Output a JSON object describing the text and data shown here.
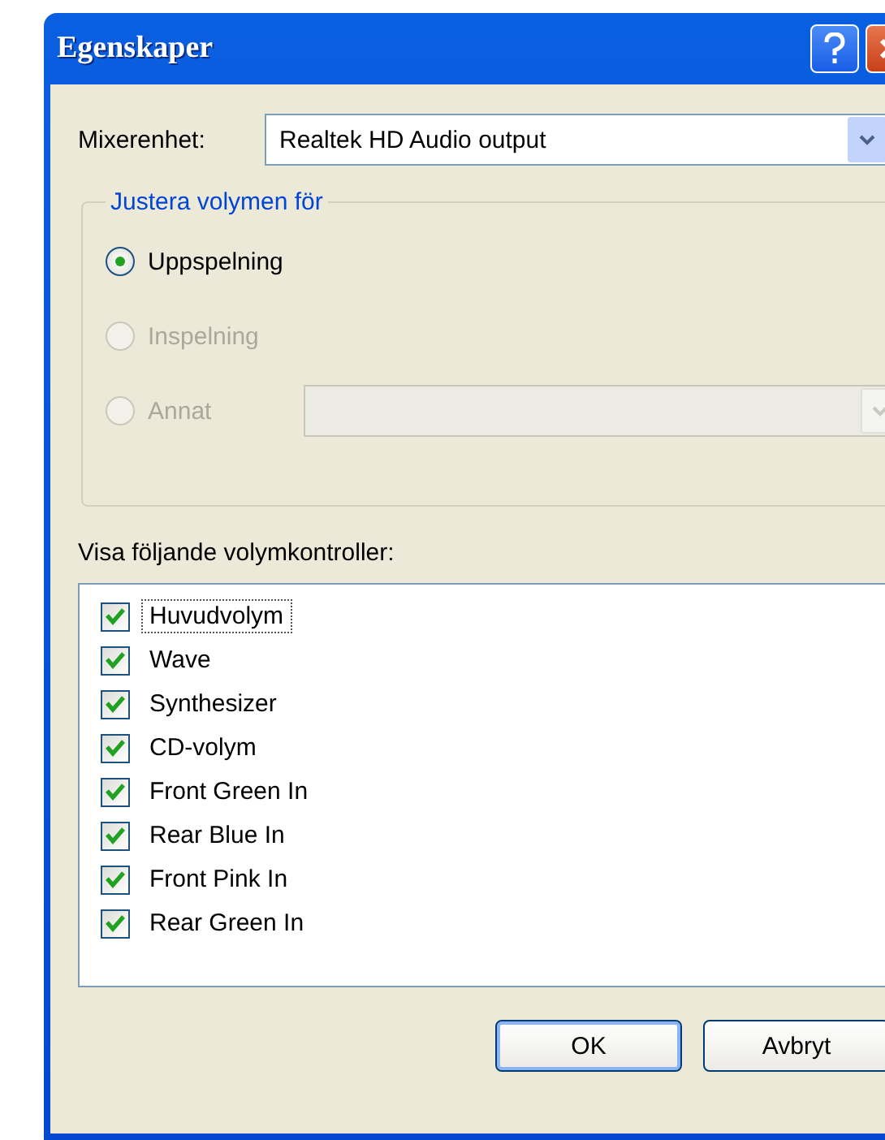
{
  "window": {
    "title": "Egenskaper"
  },
  "mixer": {
    "label": "Mixerenhet:",
    "value": "Realtek HD Audio output"
  },
  "adjust_group": {
    "legend": "Justera volymen för",
    "options": [
      {
        "kind": "plain",
        "label": "Uppspelning",
        "selected": true,
        "disabled": false
      },
      {
        "kind": "plain",
        "label": "Inspelning",
        "selected": false,
        "disabled": true
      },
      {
        "kind": "with-dropdown",
        "label": "Annat",
        "selected": false,
        "disabled": true
      }
    ]
  },
  "controls": {
    "label": "Visa följande volymkontroller:",
    "items": [
      {
        "label": "Huvudvolym",
        "checked": true,
        "focused": true
      },
      {
        "label": "Wave",
        "checked": true,
        "focused": false
      },
      {
        "label": "Synthesizer",
        "checked": true,
        "focused": false
      },
      {
        "label": "CD-volym",
        "checked": true,
        "focused": false
      },
      {
        "label": "Front Green In",
        "checked": true,
        "focused": false
      },
      {
        "label": "Rear Blue In",
        "checked": true,
        "focused": false
      },
      {
        "label": "Front Pink In",
        "checked": true,
        "focused": false
      },
      {
        "label": "Rear Green In",
        "checked": true,
        "focused": false
      }
    ]
  },
  "buttons": [
    {
      "label": "OK",
      "default": true
    },
    {
      "label": "Avbryt",
      "default": false
    }
  ]
}
